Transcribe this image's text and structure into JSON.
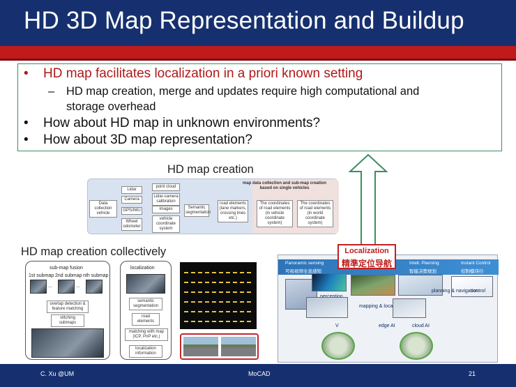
{
  "title": "HD 3D Map Representation and Buildup",
  "bullets": [
    {
      "text": "HD map facilitates localization in a priori known setting"
    },
    {
      "sub": "HD map creation, merge and updates require high computational and",
      "sub2": "storage overhead"
    },
    {
      "text": "How about HD map in unknown environments?"
    },
    {
      "text": "How about 3D map representation?"
    }
  ],
  "bullet_symbol": "•",
  "dash_symbol": "–",
  "figure_creation": {
    "label": "HD map creation",
    "header": "map data collection and sub-map creation based on single vehicles",
    "source": "Data collection vehicle",
    "sensors": [
      "Lidar",
      "Camera",
      "GPS/IMU",
      "Wheel odometer"
    ],
    "inputs": [
      "point cloud",
      "Lidar-camera calibration",
      "images",
      "vehicle coordinate system"
    ],
    "steps": [
      "Semantic segmentation",
      "road elements (lane markers, crossing lines etc.)",
      "The coordinates of road elements (in vehicle coordinate system)",
      "The coordinates of road elements (in world coordinate system)"
    ]
  },
  "figure_collective": {
    "label": "HD map creation collectively",
    "fusion_title": "sub-map fusion",
    "submaps": [
      "1st submap",
      "2nd submap",
      "nth submap"
    ],
    "ellipsis": "...",
    "fusion_steps": [
      "overlap detection & feature matching",
      "stitching submaps"
    ],
    "loc_title": "localization",
    "loc_steps": [
      "semantic segmentation",
      "road elements",
      "matching with map (ICP, PnP etc.)",
      "localization information"
    ]
  },
  "loc_figure": {
    "tag_en": "Localization",
    "tag_cn": "精準定位导航",
    "stages": [
      "Panoramic sensing",
      "Intell. Planning",
      "Instant Control"
    ],
    "stages_cn": [
      "可视视频全息感知",
      "智能决策规划",
      "控制模块行"
    ],
    "parts": [
      "perception",
      "mapping & localization",
      "planning & navigation",
      "control"
    ],
    "caps": [
      "V",
      "edge AI",
      "cloud AI"
    ]
  },
  "footer": {
    "left": "C. Xu @UM",
    "center": "MoCAD",
    "right": "21"
  },
  "colors": {
    "navy": "#16306f",
    "red": "#c11a1a",
    "green": "#3d8d5f"
  }
}
